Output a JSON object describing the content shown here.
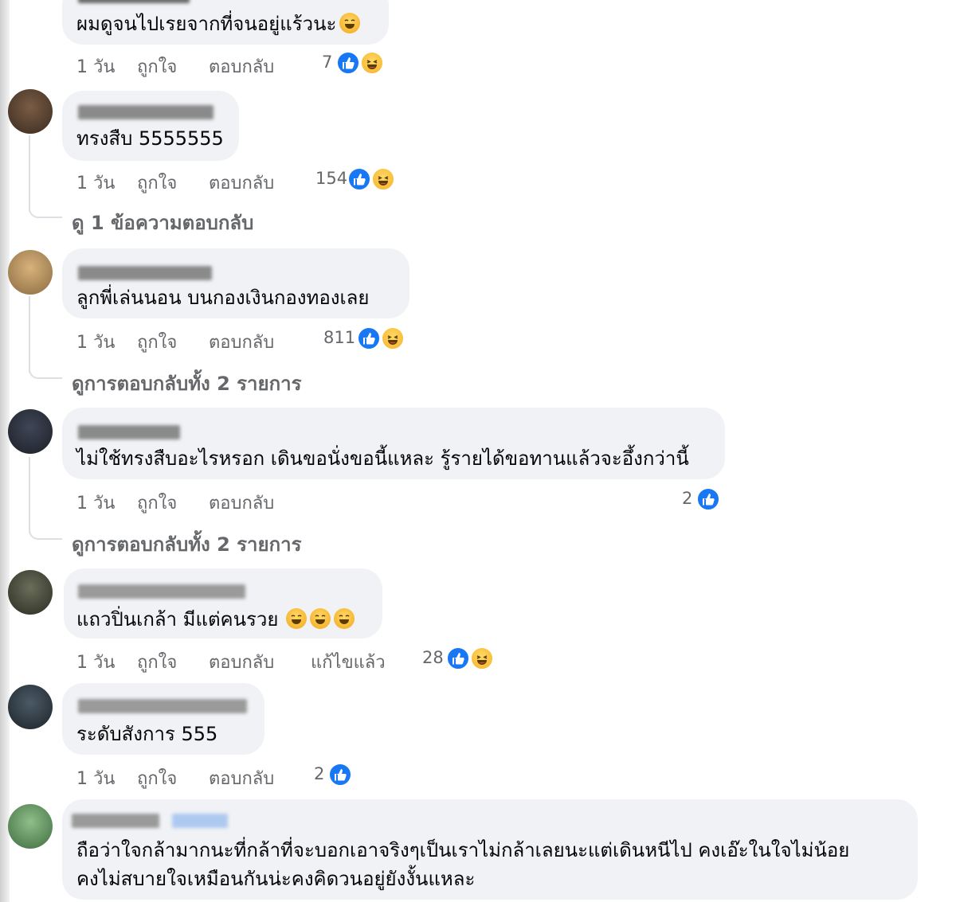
{
  "comments": [
    {
      "text": "ผมดูจนไปเรยจากที่จนอยู่แร้วนะ",
      "time": "1 วัน",
      "like_label": "ถูกใจ",
      "reply_label": "ตอบกลับ",
      "reaction_count": "7"
    },
    {
      "text": "ทรงสืบ 5555555",
      "time": "1 วัน",
      "like_label": "ถูกใจ",
      "reply_label": "ตอบกลับ",
      "reaction_count": "154",
      "view_replies": "ดู 1 ข้อความตอบกลับ"
    },
    {
      "text": "ลูกพี่เล่นนอน บนกองเงินกองทองเลย",
      "time": "1 วัน",
      "like_label": "ถูกใจ",
      "reply_label": "ตอบกลับ",
      "reaction_count": "811",
      "view_replies": "ดูการตอบกลับทั้ง 2 รายการ"
    },
    {
      "text": "ไม่ใช้ทรงสืบอะไรหรอก เดินขอนั่งขอนี้แหละ รู้รายได้ขอทานแล้วจะอึ้งกว่านี้",
      "time": "1 วัน",
      "like_label": "ถูกใจ",
      "reply_label": "ตอบกลับ",
      "reaction_count": "2",
      "view_replies": "ดูการตอบกลับทั้ง 2 รายการ"
    },
    {
      "text": "แถวปิ่นเกล้า มีแต่คนรวย",
      "time": "1 วัน",
      "like_label": "ถูกใจ",
      "reply_label": "ตอบกลับ",
      "edited_label": "แก้ไขแล้ว",
      "reaction_count": "28"
    },
    {
      "text": "ระดับสังการ 555",
      "time": "1 วัน",
      "like_label": "ถูกใจ",
      "reply_label": "ตอบกลับ",
      "reaction_count": "2"
    },
    {
      "text_line1": "ถือว่าใจกล้ามากนะที่กล้าที่จะบอกเอาจริงๆเป็นเราไม่กล้าเลยนะแต่เดินหนีไป คงเอ๊ะในใจไม่น้อย",
      "text_line2": "คงไม่สบายใจเหมือนกันน่ะคงคิดวนอยู่ยังงั้นแหละ"
    }
  ],
  "icons": {
    "like": "like-icon",
    "haha": "haha-icon",
    "laugh_emoji": "rofl-emoji",
    "smile_emoji": "smile-emoji"
  },
  "colors": {
    "like_blue": "#1877f2",
    "bubble_bg": "#f0f2f5",
    "meta_gray": "#65676b"
  }
}
